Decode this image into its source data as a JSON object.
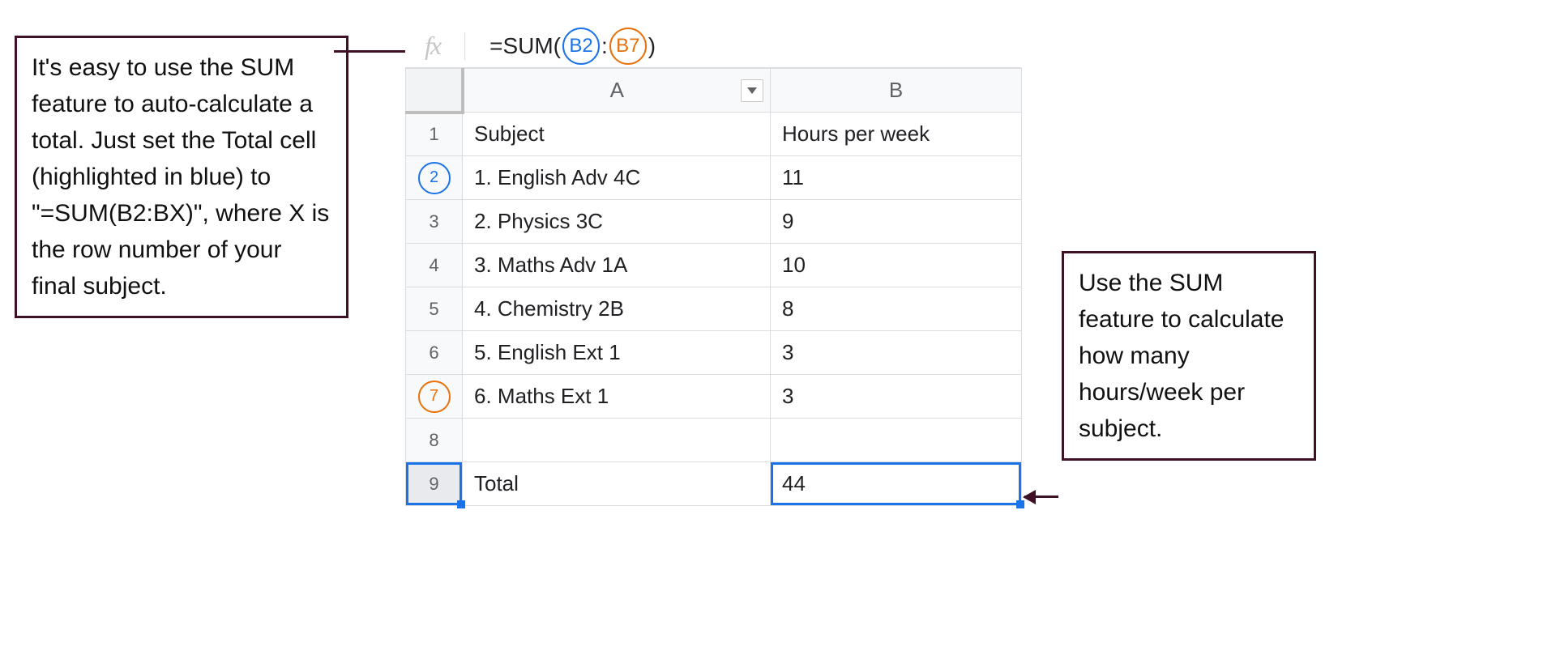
{
  "left_annotation": "It's easy to use the SUM feature to auto-calculate a total. Just set the Total cell (highlighted in blue) to \"=SUM(B2:BX)\", where X is the row number of your final subject.",
  "right_annotation": "Use the SUM feature to calculate how many hours/week per subject.",
  "formula": {
    "fx_label": "fx",
    "prefix": "=SUM(",
    "ref1": "B2",
    "colon": ":",
    "ref2": "B7",
    "suffix": ")"
  },
  "columns": {
    "A": "A",
    "B": "B"
  },
  "rows": [
    {
      "n": "1",
      "a": "Subject",
      "b": "Hours per week",
      "b_align": "left",
      "circle": "",
      "selected_row": false
    },
    {
      "n": "2",
      "a": "1. English Adv 4C",
      "b": "11",
      "b_align": "right",
      "circle": "blue",
      "selected_row": false
    },
    {
      "n": "3",
      "a": "2. Physics 3C",
      "b": "9",
      "b_align": "right",
      "circle": "",
      "selected_row": false
    },
    {
      "n": "4",
      "a": "3. Maths Adv 1A",
      "b": "10",
      "b_align": "right",
      "circle": "",
      "selected_row": false
    },
    {
      "n": "5",
      "a": "4. Chemistry 2B",
      "b": "8",
      "b_align": "right",
      "circle": "",
      "selected_row": false
    },
    {
      "n": "6",
      "a": "5. English Ext 1",
      "b": "3",
      "b_align": "right",
      "circle": "",
      "selected_row": false
    },
    {
      "n": "7",
      "a": "6. Maths Ext 1",
      "b": "3",
      "b_align": "right",
      "circle": "orange",
      "selected_row": false
    },
    {
      "n": "8",
      "a": "",
      "b": "",
      "b_align": "right",
      "circle": "",
      "selected_row": false
    },
    {
      "n": "9",
      "a": "Total",
      "b": "44",
      "b_align": "right",
      "circle": "",
      "selected_row": true
    }
  ],
  "chart_data": {
    "type": "table",
    "columns": [
      "Subject",
      "Hours per week"
    ],
    "rows": [
      [
        "1. English Adv 4C",
        11
      ],
      [
        "2. Physics 3C",
        9
      ],
      [
        "3. Maths Adv 1A",
        10
      ],
      [
        "4. Chemistry 2B",
        8
      ],
      [
        "5. English Ext 1",
        3
      ],
      [
        "6. Maths Ext 1",
        3
      ]
    ],
    "total_label": "Total",
    "total_value": 44,
    "formula": "=SUM(B2:B7)"
  }
}
